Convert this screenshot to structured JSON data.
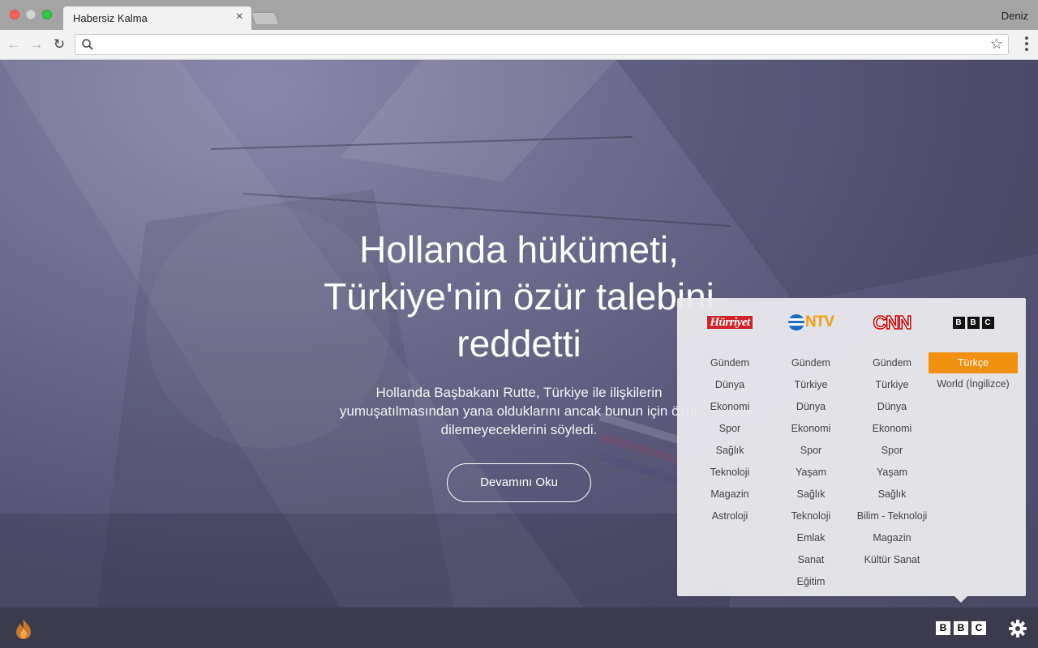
{
  "browser": {
    "tab_title": "Habersiz Kalma",
    "tab_close": "×",
    "profile_name": "Deniz",
    "address_value": "",
    "star": "☆",
    "back": "←",
    "forward": "→",
    "reload": "↻"
  },
  "hero": {
    "headline": "Hollanda hükümeti, Türkiye'nin özür talebini reddetti",
    "summary": "Hollanda Başbakanı Rutte, Türkiye ile ilişkilerin yumuşatılmasından yana olduklarını ancak bunun için özür dilemeyeceklerini söyledi.",
    "read_more": "Devamını Oku"
  },
  "sources": [
    {
      "name": "Hürriyet",
      "logo_text": "Hürriyet",
      "categories": [
        "Gündem",
        "Dünya",
        "Ekonomi",
        "Spor",
        "Sağlık",
        "Teknoloji",
        "Magazin",
        "Astroloji"
      ]
    },
    {
      "name": "NTV",
      "logo_text": "NTV",
      "categories": [
        "Gündem",
        "Türkiye",
        "Dünya",
        "Ekonomi",
        "Spor",
        "Yaşam",
        "Sağlık",
        "Teknoloji",
        "Emlak",
        "Sanat",
        "Eğitim"
      ]
    },
    {
      "name": "CNN",
      "logo_text": "CNN",
      "categories": [
        "Gündem",
        "Türkiye",
        "Dünya",
        "Ekonomi",
        "Spor",
        "Yaşam",
        "Sağlık",
        "Bilim - Teknoloji",
        "Magazin",
        "Kültür Sanat"
      ]
    },
    {
      "name": "BBC",
      "logo_letters": [
        "B",
        "B",
        "C"
      ],
      "categories": [
        "Türkçe",
        "World (İngilizce)"
      ],
      "active_category": "Türkçe"
    }
  ],
  "bottombar": {
    "current_source_letters": [
      "B",
      "B",
      "C"
    ]
  },
  "colors": {
    "accent": "#f0900e",
    "hurriyet_red": "#d2232a",
    "cnn_red": "#cc0000",
    "ntv_blue": "#1d6cc4",
    "ntv_orange": "#f0a013"
  }
}
